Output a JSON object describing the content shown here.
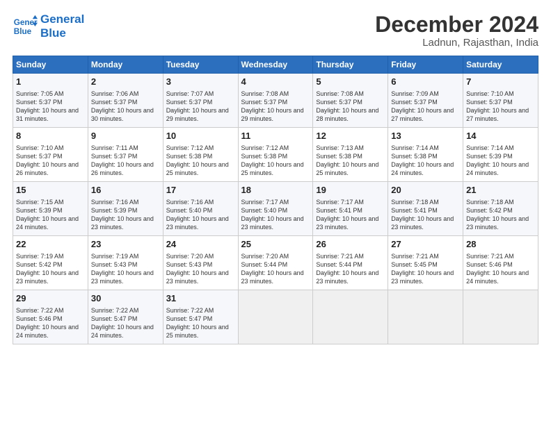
{
  "logo": {
    "line1": "General",
    "line2": "Blue"
  },
  "title": "December 2024",
  "subtitle": "Ladnun, Rajasthan, India",
  "days_of_week": [
    "Sunday",
    "Monday",
    "Tuesday",
    "Wednesday",
    "Thursday",
    "Friday",
    "Saturday"
  ],
  "weeks": [
    [
      {
        "day": "1",
        "sunrise": "7:05 AM",
        "sunset": "5:37 PM",
        "daylight": "10 hours and 31 minutes."
      },
      {
        "day": "2",
        "sunrise": "7:06 AM",
        "sunset": "5:37 PM",
        "daylight": "10 hours and 30 minutes."
      },
      {
        "day": "3",
        "sunrise": "7:07 AM",
        "sunset": "5:37 PM",
        "daylight": "10 hours and 29 minutes."
      },
      {
        "day": "4",
        "sunrise": "7:08 AM",
        "sunset": "5:37 PM",
        "daylight": "10 hours and 29 minutes."
      },
      {
        "day": "5",
        "sunrise": "7:08 AM",
        "sunset": "5:37 PM",
        "daylight": "10 hours and 28 minutes."
      },
      {
        "day": "6",
        "sunrise": "7:09 AM",
        "sunset": "5:37 PM",
        "daylight": "10 hours and 27 minutes."
      },
      {
        "day": "7",
        "sunrise": "7:10 AM",
        "sunset": "5:37 PM",
        "daylight": "10 hours and 27 minutes."
      }
    ],
    [
      {
        "day": "8",
        "sunrise": "7:10 AM",
        "sunset": "5:37 PM",
        "daylight": "10 hours and 26 minutes."
      },
      {
        "day": "9",
        "sunrise": "7:11 AM",
        "sunset": "5:37 PM",
        "daylight": "10 hours and 26 minutes."
      },
      {
        "day": "10",
        "sunrise": "7:12 AM",
        "sunset": "5:38 PM",
        "daylight": "10 hours and 25 minutes."
      },
      {
        "day": "11",
        "sunrise": "7:12 AM",
        "sunset": "5:38 PM",
        "daylight": "10 hours and 25 minutes."
      },
      {
        "day": "12",
        "sunrise": "7:13 AM",
        "sunset": "5:38 PM",
        "daylight": "10 hours and 25 minutes."
      },
      {
        "day": "13",
        "sunrise": "7:14 AM",
        "sunset": "5:38 PM",
        "daylight": "10 hours and 24 minutes."
      },
      {
        "day": "14",
        "sunrise": "7:14 AM",
        "sunset": "5:39 PM",
        "daylight": "10 hours and 24 minutes."
      }
    ],
    [
      {
        "day": "15",
        "sunrise": "7:15 AM",
        "sunset": "5:39 PM",
        "daylight": "10 hours and 24 minutes."
      },
      {
        "day": "16",
        "sunrise": "7:16 AM",
        "sunset": "5:39 PM",
        "daylight": "10 hours and 23 minutes."
      },
      {
        "day": "17",
        "sunrise": "7:16 AM",
        "sunset": "5:40 PM",
        "daylight": "10 hours and 23 minutes."
      },
      {
        "day": "18",
        "sunrise": "7:17 AM",
        "sunset": "5:40 PM",
        "daylight": "10 hours and 23 minutes."
      },
      {
        "day": "19",
        "sunrise": "7:17 AM",
        "sunset": "5:41 PM",
        "daylight": "10 hours and 23 minutes."
      },
      {
        "day": "20",
        "sunrise": "7:18 AM",
        "sunset": "5:41 PM",
        "daylight": "10 hours and 23 minutes."
      },
      {
        "day": "21",
        "sunrise": "7:18 AM",
        "sunset": "5:42 PM",
        "daylight": "10 hours and 23 minutes."
      }
    ],
    [
      {
        "day": "22",
        "sunrise": "7:19 AM",
        "sunset": "5:42 PM",
        "daylight": "10 hours and 23 minutes."
      },
      {
        "day": "23",
        "sunrise": "7:19 AM",
        "sunset": "5:43 PM",
        "daylight": "10 hours and 23 minutes."
      },
      {
        "day": "24",
        "sunrise": "7:20 AM",
        "sunset": "5:43 PM",
        "daylight": "10 hours and 23 minutes."
      },
      {
        "day": "25",
        "sunrise": "7:20 AM",
        "sunset": "5:44 PM",
        "daylight": "10 hours and 23 minutes."
      },
      {
        "day": "26",
        "sunrise": "7:21 AM",
        "sunset": "5:44 PM",
        "daylight": "10 hours and 23 minutes."
      },
      {
        "day": "27",
        "sunrise": "7:21 AM",
        "sunset": "5:45 PM",
        "daylight": "10 hours and 23 minutes."
      },
      {
        "day": "28",
        "sunrise": "7:21 AM",
        "sunset": "5:46 PM",
        "daylight": "10 hours and 24 minutes."
      }
    ],
    [
      {
        "day": "29",
        "sunrise": "7:22 AM",
        "sunset": "5:46 PM",
        "daylight": "10 hours and 24 minutes."
      },
      {
        "day": "30",
        "sunrise": "7:22 AM",
        "sunset": "5:47 PM",
        "daylight": "10 hours and 24 minutes."
      },
      {
        "day": "31",
        "sunrise": "7:22 AM",
        "sunset": "5:47 PM",
        "daylight": "10 hours and 25 minutes."
      },
      null,
      null,
      null,
      null
    ]
  ]
}
